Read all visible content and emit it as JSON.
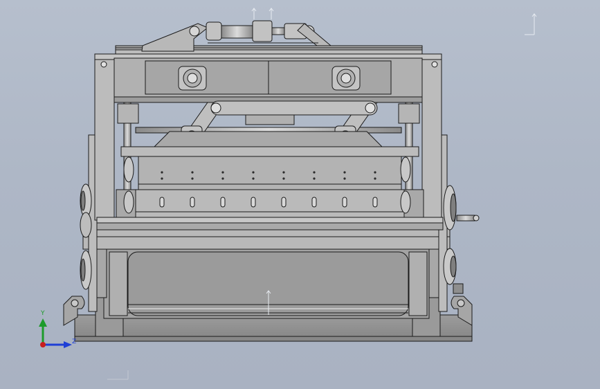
{
  "scene": {
    "title": "",
    "background_top": "#b6bfcd",
    "background_bottom": "#a9b2c2",
    "part_color": "#b4b4b4",
    "edge_color": "#1a1a1a"
  },
  "triad": {
    "y_label": "Y",
    "z_label": "Z",
    "y_color": "#1d9b2a",
    "z_color": "#1f3fd6",
    "x_color": "#c81e1e"
  }
}
